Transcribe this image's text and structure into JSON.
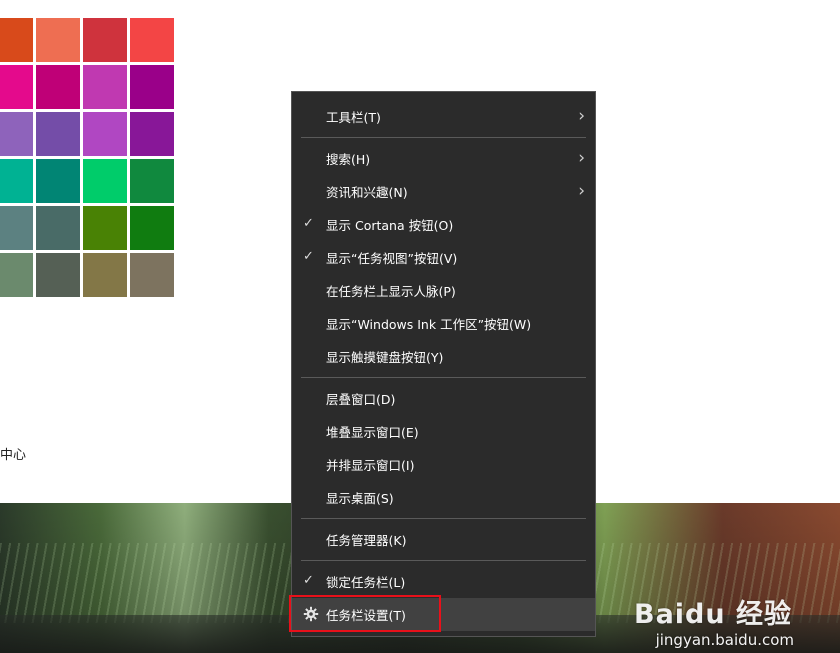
{
  "palette": {
    "swatches": [
      "#d84a1b",
      "#ee6e52",
      "#cf333d",
      "#f34545",
      "#e40a8c",
      "#bf0077",
      "#c039b1",
      "#9a0089",
      "#8e63bb",
      "#744da8",
      "#b047c2",
      "#881798",
      "#00b293",
      "#018574",
      "#00cc6a",
      "#10893e",
      "#5c8181",
      "#496b67",
      "#498205",
      "#107c10",
      "#6b8a6d",
      "#556055",
      "#837747",
      "#7d735f"
    ]
  },
  "side_text": "中心",
  "watermark": {
    "logo": "Baidu 经验",
    "url": "jingyan.baidu.com"
  },
  "context_menu": {
    "items": [
      {
        "label": "工具栏(T)",
        "checked": false,
        "submenu": true
      },
      {
        "label": "搜索(H)",
        "checked": false,
        "submenu": true
      },
      {
        "label": "资讯和兴趣(N)",
        "checked": false,
        "submenu": true
      },
      {
        "label": "显示 Cortana 按钮(O)",
        "checked": true,
        "submenu": false
      },
      {
        "label": "显示“任务视图”按钮(V)",
        "checked": true,
        "submenu": false
      },
      {
        "label": "在任务栏上显示人脉(P)",
        "checked": false,
        "submenu": false
      },
      {
        "label": "显示“Windows Ink 工作区”按钮(W)",
        "checked": false,
        "submenu": false
      },
      {
        "label": "显示触摸键盘按钮(Y)",
        "checked": false,
        "submenu": false
      },
      {
        "label": "层叠窗口(D)",
        "checked": false,
        "submenu": false
      },
      {
        "label": "堆叠显示窗口(E)",
        "checked": false,
        "submenu": false
      },
      {
        "label": "并排显示窗口(I)",
        "checked": false,
        "submenu": false
      },
      {
        "label": "显示桌面(S)",
        "checked": false,
        "submenu": false
      },
      {
        "label": "任务管理器(K)",
        "checked": false,
        "submenu": false
      },
      {
        "label": "锁定任务栏(L)",
        "checked": true,
        "submenu": false
      },
      {
        "label": "任务栏设置(T)",
        "checked": false,
        "submenu": false,
        "icon": "gear-icon",
        "highlighted": true
      }
    ],
    "check_glyph": "✓",
    "arrow_glyph": "›",
    "highlight_color": "#e8101a"
  }
}
